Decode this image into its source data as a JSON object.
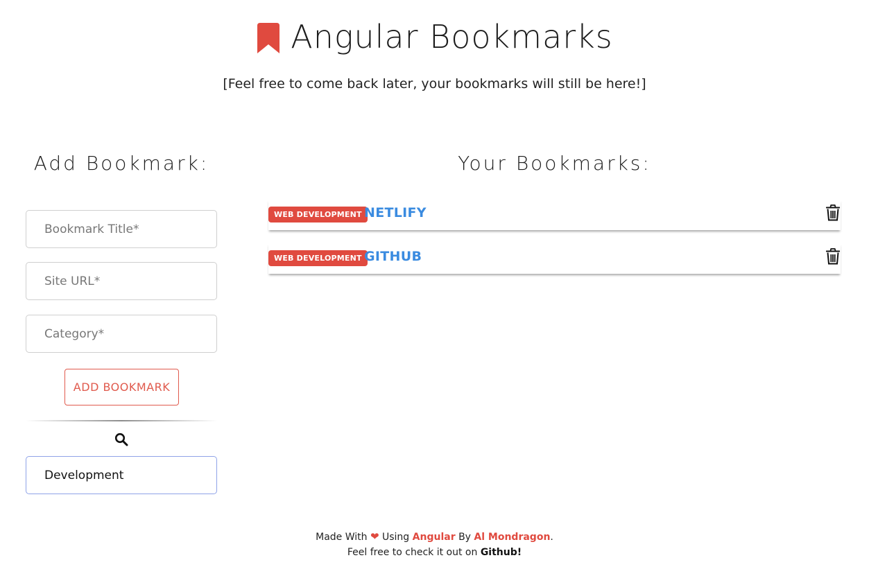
{
  "header": {
    "title": "Angular Bookmarks",
    "subtitle": "[Feel free to come back later, your bookmarks will still be here!]",
    "logo_icon": "bookmark-icon",
    "accent_color": "#e04a3f"
  },
  "add_form": {
    "heading": "Add Bookmark:",
    "title_placeholder": "Bookmark Title*",
    "url_placeholder": "Site URL*",
    "category_placeholder": "Category*",
    "submit_label": "ADD BOOKMARK",
    "search_icon": "search-icon",
    "search_value": "Development"
  },
  "bookmarks": {
    "heading": "Your Bookmarks:",
    "items": [
      {
        "category": "WEB DEVELOPMENT",
        "title": "NETLIFY",
        "delete_icon": "trash-icon"
      },
      {
        "category": "WEB DEVELOPMENT",
        "title": "GITHUB",
        "delete_icon": "trash-icon"
      }
    ],
    "link_color": "#3a8be0",
    "badge_color": "#e04a3f"
  },
  "footer": {
    "made_with": "Made With",
    "heart_icon": "heart-icon",
    "using": "Using",
    "framework": "Angular",
    "by": "By",
    "author": "Al Mondragon",
    "period": ".",
    "check_out": "Feel free to check it out on",
    "repo_link": "Github!"
  }
}
